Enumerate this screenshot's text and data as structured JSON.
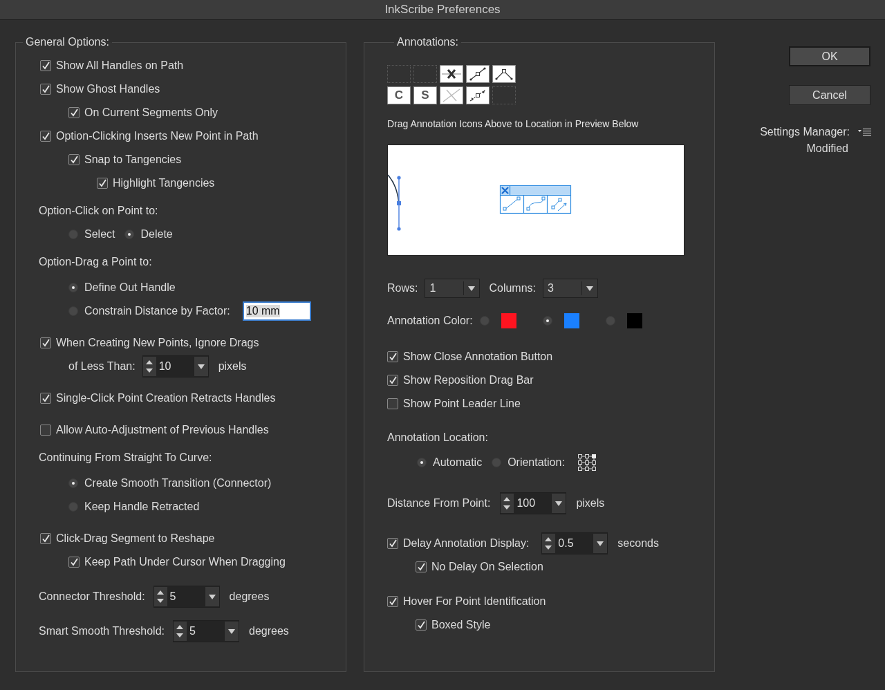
{
  "window": {
    "title": "InkScribe Preferences"
  },
  "general": {
    "title": "General Options:",
    "items": [
      {
        "kind": "checkbox",
        "label": "Show All Handles on Path",
        "checked": true
      },
      {
        "kind": "checkbox",
        "label": "Show Ghost Handles",
        "checked": true,
        "children": [
          {
            "kind": "checkbox",
            "label": "On Current Segments Only",
            "checked": true
          }
        ]
      },
      {
        "kind": "checkbox",
        "label": "Option-Clicking Inserts New Point in Path",
        "checked": true,
        "children": [
          {
            "kind": "checkbox",
            "label": "Snap to Tangencies",
            "checked": true,
            "children": [
              {
                "kind": "checkbox",
                "label": "Highlight Tangencies",
                "checked": true
              }
            ]
          }
        ]
      },
      {
        "kind": "heading",
        "label": "Option-Click on Point to:"
      },
      {
        "kind": "radio-row",
        "options": [
          {
            "label": "Select",
            "selected": false
          },
          {
            "label": "Delete",
            "selected": true
          }
        ]
      },
      {
        "kind": "heading",
        "label": "Option-Drag a Point to:"
      },
      {
        "kind": "radio-list",
        "options": [
          {
            "label": "Define Out Handle",
            "selected": true
          },
          {
            "label": "Constrain Distance by Factor:",
            "selected": false,
            "field": "10 mm"
          }
        ]
      },
      {
        "kind": "checkbox",
        "label": "When Creating New Points, Ignore Drags",
        "checked": true,
        "children": [
          {
            "kind": "spinner",
            "label": "of Less Than:",
            "value": "10",
            "unit": "pixels"
          }
        ]
      },
      {
        "kind": "checkbox",
        "label": "Single-Click Point Creation Retracts Handles",
        "checked": true
      },
      {
        "kind": "checkbox",
        "label": "Allow Auto-Adjustment of Previous Handles",
        "checked": false
      },
      {
        "kind": "heading",
        "label": "Continuing From Straight To Curve:"
      },
      {
        "kind": "radio-list",
        "options": [
          {
            "label": "Create Smooth Transition (Connector)",
            "selected": true
          },
          {
            "label": "Keep Handle Retracted",
            "selected": false
          }
        ]
      },
      {
        "kind": "checkbox",
        "label": "Click-Drag Segment to Reshape",
        "checked": true,
        "children": [
          {
            "kind": "checkbox",
            "label": "Keep Path Under Cursor When Dragging",
            "checked": true
          }
        ]
      },
      {
        "kind": "spinner",
        "label": "Connector Threshold:",
        "value": "5",
        "unit": "degrees"
      },
      {
        "kind": "spinner",
        "label": "Smart Smooth Threshold:",
        "value": "5",
        "unit": "degrees"
      }
    ]
  },
  "annotations": {
    "title": "Annotations:",
    "palette": [
      [
        {
          "kind": "empty"
        },
        {
          "kind": "empty"
        },
        {
          "kind": "close"
        },
        {
          "kind": "segment"
        },
        {
          "kind": "corner"
        }
      ],
      [
        {
          "kind": "letter",
          "text": "C"
        },
        {
          "kind": "letter",
          "text": "S"
        },
        {
          "kind": "no-close"
        },
        {
          "kind": "arrows"
        },
        {
          "kind": "empty"
        }
      ]
    ],
    "hint": "Drag Annotation Icons Above to Location in Preview Below",
    "rows": {
      "label": "Rows:",
      "value": "1"
    },
    "columns": {
      "label": "Columns:",
      "value": "3"
    },
    "color": {
      "label": "Annotation Color:",
      "options": [
        {
          "color": "#ff1420",
          "selected": false
        },
        {
          "color": "#1a80ff",
          "selected": true
        },
        {
          "color": "#000000",
          "selected": false
        }
      ]
    },
    "checks": [
      {
        "label": "Show Close Annotation Button",
        "checked": true
      },
      {
        "label": "Show Reposition Drag Bar",
        "checked": true
      },
      {
        "label": "Show Point Leader Line",
        "checked": false
      }
    ],
    "location": {
      "label": "Annotation Location:",
      "options": [
        {
          "label": "Automatic",
          "selected": true
        },
        {
          "label": "Orientation:",
          "selected": false
        }
      ]
    },
    "distance": {
      "label": "Distance From Point:",
      "value": "100",
      "unit": "pixels"
    },
    "delay": {
      "label": "Delay Annotation Display:",
      "checked": true,
      "value": "0.5",
      "unit": "seconds",
      "children": [
        {
          "label": "No Delay On Selection",
          "checked": true
        }
      ]
    },
    "hover": {
      "label": "Hover For Point Identification",
      "checked": true,
      "children": [
        {
          "label": "Boxed Style",
          "checked": true
        }
      ]
    }
  },
  "buttons": [
    {
      "label": "OK",
      "default": true
    },
    {
      "label": "Cancel",
      "default": false
    }
  ],
  "settings": {
    "label": "Settings Manager:",
    "value": "Modified"
  }
}
